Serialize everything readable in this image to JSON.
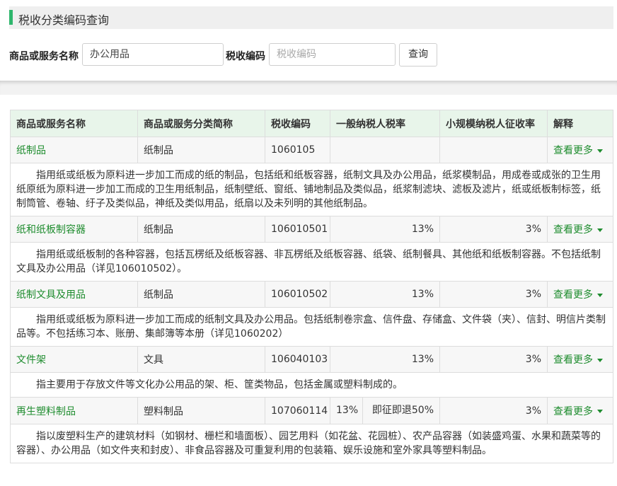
{
  "header": {
    "title": "税收分类编码查询"
  },
  "search": {
    "name_label": "商品或服务名称",
    "name_value": "办公用品",
    "code_label": "税收编码",
    "code_placeholder": "税收编码",
    "button_label": "查询"
  },
  "table": {
    "headers": [
      "商品或服务名称",
      "商品或服务分类简称",
      "税收编码",
      "一般纳税人税率",
      "小规模纳税人征收率",
      "解释"
    ],
    "more_label": "查看更多",
    "rows": [
      {
        "name": "纸制品",
        "category": "纸制品",
        "code": "1060105",
        "general_rate": "",
        "small_rate": "",
        "desc": "指用纸或纸板为原料进一步加工而成的纸的制品，包括纸和纸板容器，纸制文具及办公用品，纸浆模制品，用成卷或成张的卫生用纸原纸为原料进一步加工而成的卫生用纸制品，纸制壁纸、窗纸、铺地制品及类似品，纸浆制滤块、滤板及滤片，纸或纸板制标签，纸制筒管、卷轴、纡子及类似品，神纸及类似用品，纸扇以及未列明的其他纸制品。"
      },
      {
        "name": "纸和纸板制容器",
        "category": "纸制品",
        "code": "106010501",
        "general_rate": "13%",
        "small_rate": "3%",
        "desc": "指用纸或纸板制的各种容器，包括瓦楞纸及纸板容器、非瓦楞纸及纸板容器、纸袋、纸制餐具、其他纸和纸板制容器。不包括纸制文具及办公用品（详见106010502）。"
      },
      {
        "name": "纸制文具及用品",
        "category": "纸制品",
        "code": "106010502",
        "general_rate": "13%",
        "small_rate": "3%",
        "desc": "指用纸或纸板为原料进一步加工而成的纸制文具及办公用品。包括纸制卷宗盒、信件盘、存储盒、文件袋（夹）、信封、明信片类制品等。不包括练习本、账册、集邮簿等本册（详见1060202）"
      },
      {
        "name": "文件架",
        "category": "文具",
        "code": "106040103",
        "general_rate": "13%",
        "small_rate": "3%",
        "desc": "指主要用于存放文件等文化办公用品的架、柜、筐类物品，包括金属或塑料制成的。"
      },
      {
        "name": "再生塑料制品",
        "category": "塑料制品",
        "code": "107060114",
        "general_rate": "13%",
        "general_note": "即征即退50%",
        "small_rate": "3%",
        "desc": "指以废塑料生产的建筑材料（如钢材、栅栏和墙面板）、园艺用料（如花盆、花园桩）、农产品容器（如装盛鸡蛋、水果和蔬菜等的容器）、办公用品（如文件夹和封皮）、非食品容器及可重复利用的包装箱、娱乐设施和室外家具等塑料制品。"
      }
    ]
  },
  "colors": {
    "accent": "#2fb66d",
    "link": "#1e8c2e",
    "header_bg": "#e8f5ea"
  }
}
